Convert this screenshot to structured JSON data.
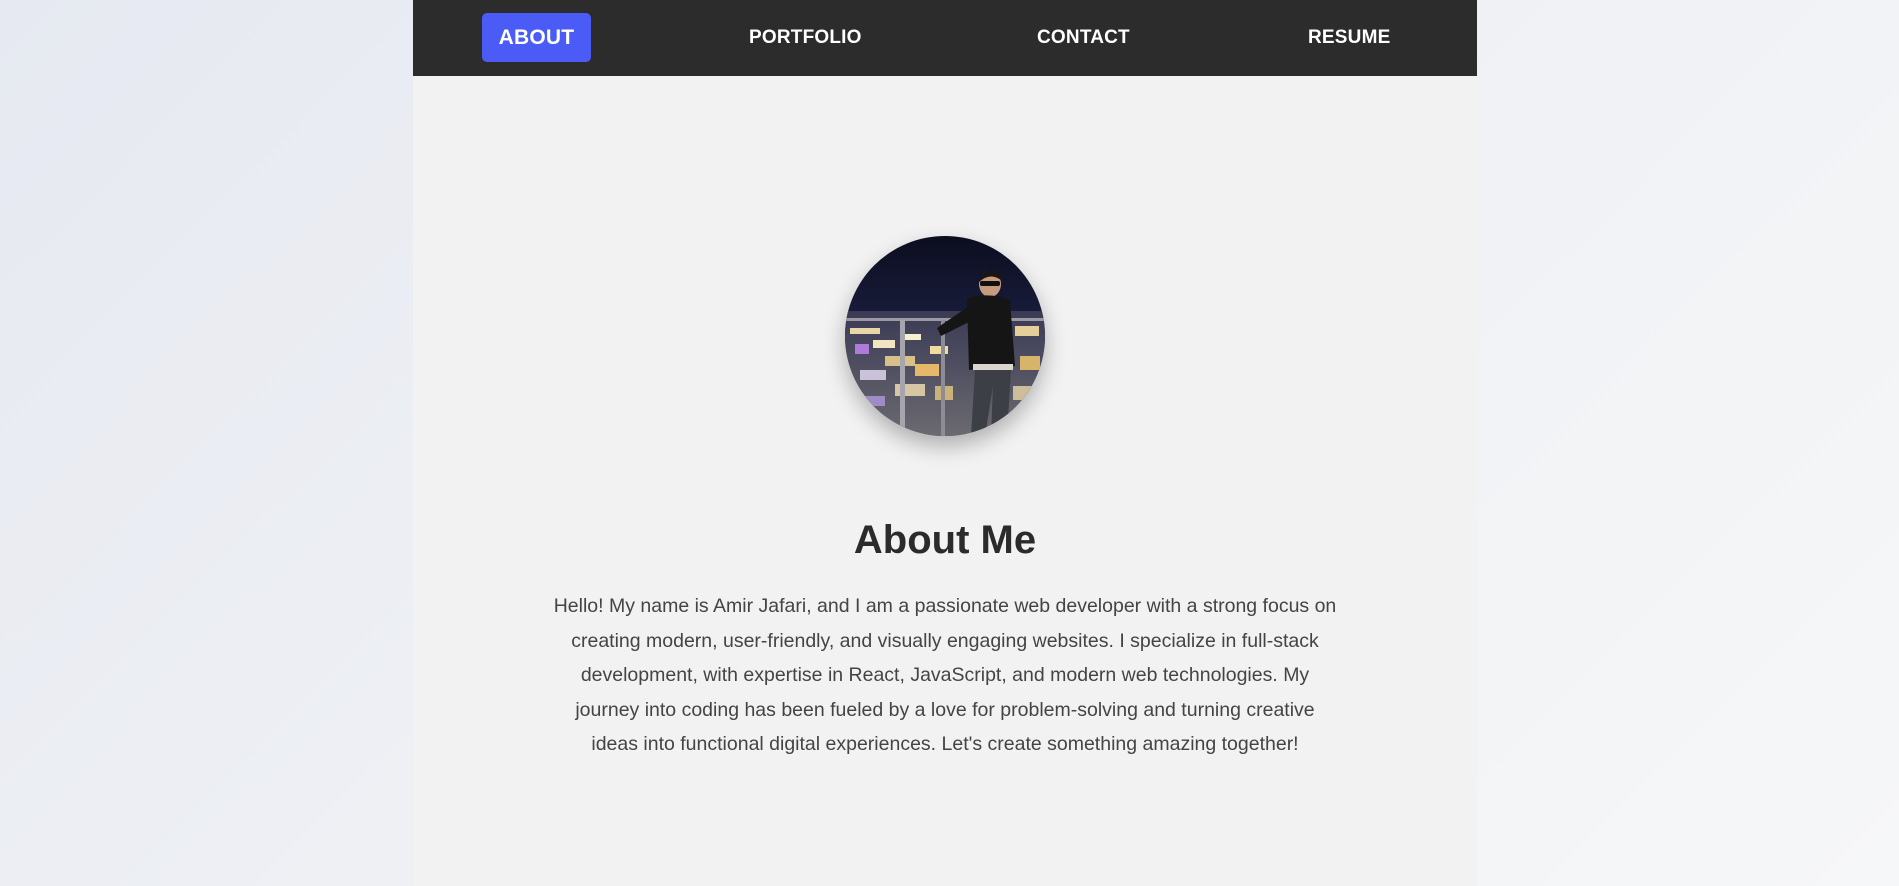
{
  "nav": {
    "items": [
      {
        "label": "ABOUT",
        "active": true
      },
      {
        "label": "PORTFOLIO",
        "active": false
      },
      {
        "label": "CONTACT",
        "active": false
      },
      {
        "label": "RESUME",
        "active": false
      }
    ],
    "active_color": "#4a5cf5",
    "background_color": "#2c2c2c"
  },
  "profile": {
    "avatar_icon": "profile-photo"
  },
  "about": {
    "title": "About Me",
    "body": "Hello! My name is Amir Jafari, and I am a passionate web developer with a strong focus on creating modern, user-friendly, and visually engaging websites. I specialize in full-stack development, with expertise in React, JavaScript, and modern web technologies. My journey into coding has been fueled by a love for problem-solving and turning creative ideas into functional digital experiences. Let's create something amazing together!"
  }
}
